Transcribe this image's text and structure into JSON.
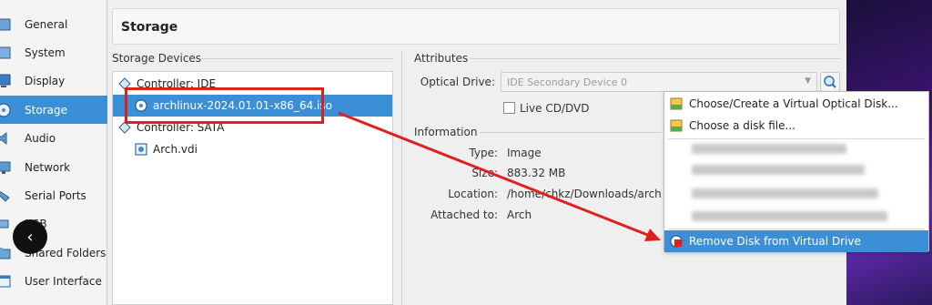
{
  "sidebar": {
    "items": [
      {
        "label": "General",
        "icon": "general-icon"
      },
      {
        "label": "System",
        "icon": "system-icon"
      },
      {
        "label": "Display",
        "icon": "display-icon"
      },
      {
        "label": "Storage",
        "icon": "storage-icon",
        "active": true
      },
      {
        "label": "Audio",
        "icon": "audio-icon"
      },
      {
        "label": "Network",
        "icon": "network-icon"
      },
      {
        "label": "Serial Ports",
        "icon": "serial-ports-icon"
      },
      {
        "label": "USB",
        "icon": "usb-icon"
      },
      {
        "label": "Shared Folders",
        "icon": "shared-folders-icon"
      },
      {
        "label": "User Interface",
        "icon": "user-interface-icon"
      }
    ],
    "back_glyph": "‹"
  },
  "page": {
    "title": "Storage"
  },
  "storage_devices": {
    "heading": "Storage Devices",
    "rows": [
      {
        "label": "Controller: IDE",
        "kind": "controller"
      },
      {
        "label": "archlinux-2024.01.01-x86_64.iso",
        "kind": "optical",
        "selected": true
      },
      {
        "label": "Controller: SATA",
        "kind": "controller"
      },
      {
        "label": "Arch.vdi",
        "kind": "disk"
      }
    ]
  },
  "attributes": {
    "heading": "Attributes",
    "optical_drive_label": "Optical Drive:",
    "optical_drive_value": "IDE Secondary Device 0",
    "live_cd_label": "Live CD/DVD"
  },
  "information": {
    "heading": "Information",
    "type_label": "Type:",
    "type_value": "Image",
    "size_label": "Size:",
    "size_value": "883.32 MB",
    "location_label": "Location:",
    "location_value": "/home/chkz/Downloads/archlin",
    "attached_label": "Attached to:",
    "attached_value": "Arch"
  },
  "menu": {
    "choose_create_label": "Choose/Create a Virtual Optical Disk...",
    "choose_file_label": "Choose a disk file...",
    "remove_label": "Remove Disk from Virtual Drive"
  },
  "colors": {
    "accent": "#3a8fd6",
    "annotation": "#e0201b"
  }
}
